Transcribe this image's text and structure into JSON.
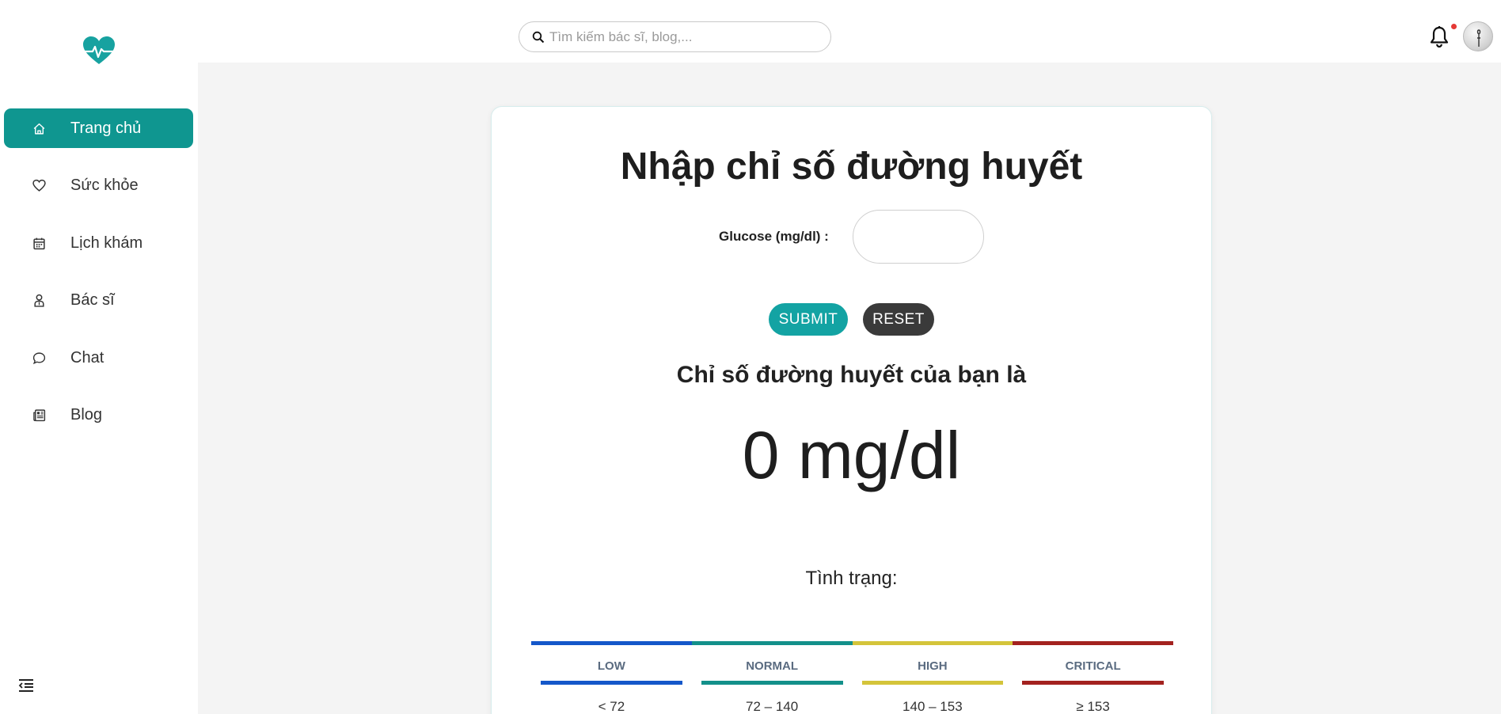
{
  "sidebar": {
    "items": [
      {
        "label": "Trang chủ",
        "icon": "home-icon",
        "active": true
      },
      {
        "label": "Sức khỏe",
        "icon": "heart-icon"
      },
      {
        "label": "Lịch khám",
        "icon": "calendar-icon"
      },
      {
        "label": "Bác sĩ",
        "icon": "doctor-icon"
      },
      {
        "label": "Chat",
        "icon": "chat-icon"
      },
      {
        "label": "Blog",
        "icon": "newspaper-icon"
      }
    ]
  },
  "search": {
    "placeholder": "Tìm kiếm bác sĩ, blog,..."
  },
  "form": {
    "title": "Nhập chỉ số đường huyết",
    "glucose_label": "Glucose (mg/dl) :",
    "glucose_value": "",
    "submit_label": "SUBMIT",
    "reset_label": "RESET"
  },
  "result": {
    "heading": "Chỉ số đường huyết của bạn là",
    "value": "0 mg/dl",
    "status_label": "Tình trạng:"
  },
  "levels": [
    {
      "name": "LOW",
      "range": "< 72",
      "color": "#1457c9"
    },
    {
      "name": "NORMAL",
      "range": "72 – 140",
      "color": "#13908a"
    },
    {
      "name": "HIGH",
      "range": "140 – 153",
      "color": "#d4c43a"
    },
    {
      "name": "CRITICAL",
      "range": "≥ 153",
      "color": "#a3221f"
    }
  ],
  "colors": {
    "accent": "#0f9690",
    "submit": "#13a3a3",
    "reset": "#3a3a3a"
  }
}
